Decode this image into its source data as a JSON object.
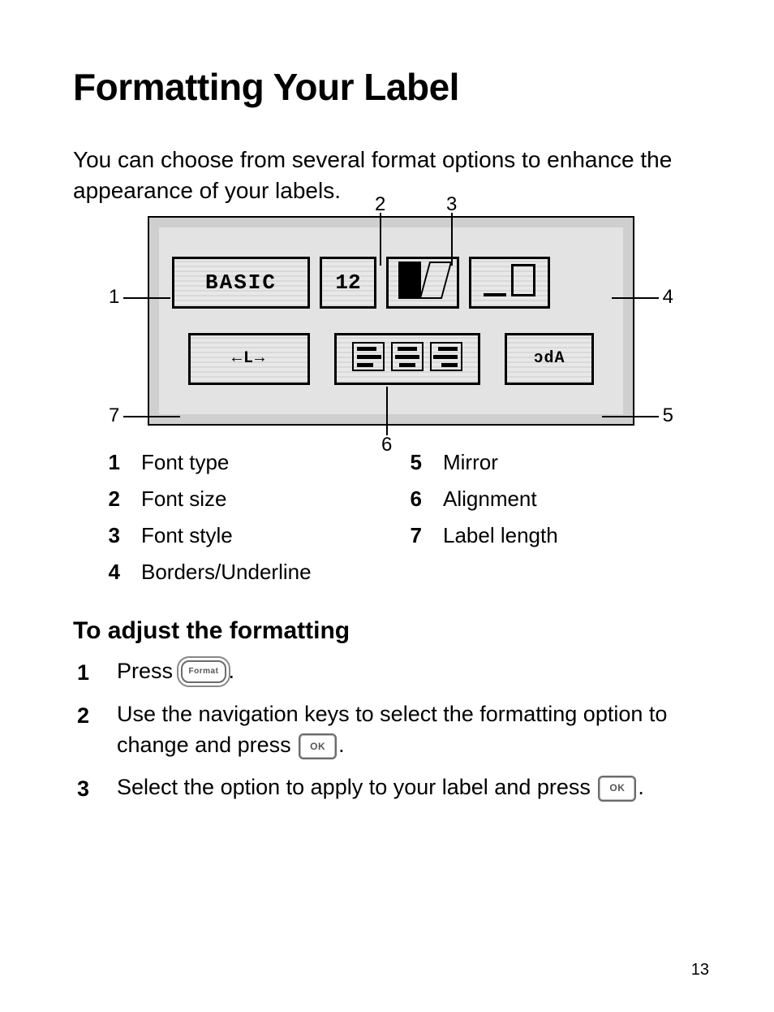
{
  "page_number": "13",
  "heading": "Formatting Your Label",
  "intro": "You can choose from several format options to enhance the appearance of your labels.",
  "screen": {
    "font_type": "BASIC",
    "font_size": "12",
    "style_icon": "bold-italic-icon",
    "borders_icon": "underline-box-icon",
    "length": "←L→",
    "alignment_icon": "align-left-center-right-icon",
    "mirror": "ɔdA"
  },
  "callouts": {
    "c1": "1",
    "c2": "2",
    "c3": "3",
    "c4": "4",
    "c5": "5",
    "c6": "6",
    "c7": "7"
  },
  "legend": [
    {
      "num": "1",
      "label": "Font type"
    },
    {
      "num": "2",
      "label": "Font size"
    },
    {
      "num": "3",
      "label": "Font style"
    },
    {
      "num": "4",
      "label": "Borders/Underline"
    },
    {
      "num": "5",
      "label": "Mirror"
    },
    {
      "num": "6",
      "label": "Alignment"
    },
    {
      "num": "7",
      "label": "Label length"
    }
  ],
  "subheading": "To adjust the formatting",
  "steps": {
    "s1_a": "Press ",
    "s1_b": ".",
    "s2_a": "Use the navigation keys to select the formatting option to change and press ",
    "s2_b": ".",
    "s3_a": "Select the option to apply to your label and press ",
    "s3_b": "."
  },
  "keys": {
    "format": "Format",
    "ok": "OK"
  }
}
